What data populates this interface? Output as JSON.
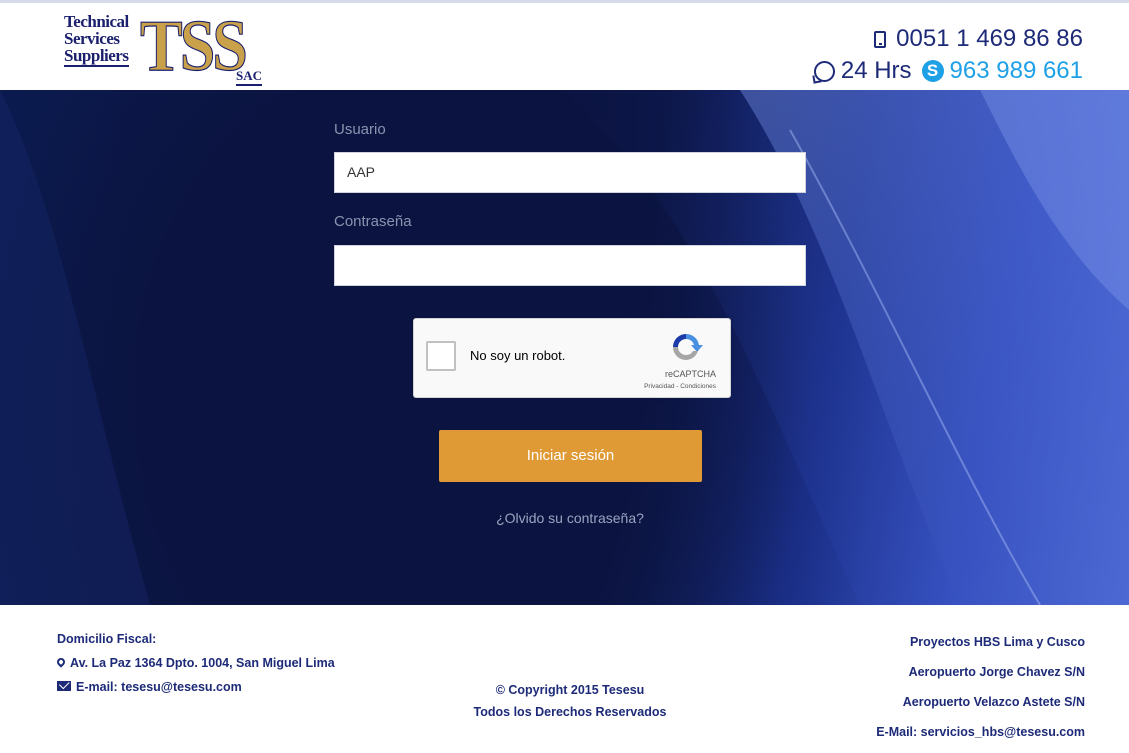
{
  "header": {
    "logo": {
      "line1": "Technical",
      "line2": "Services",
      "line3": "Suppliers",
      "letters": "TSS",
      "suffix": "SAC"
    },
    "phone": "0051 1 469 86 86",
    "hours": "24 Hrs",
    "skype_number": "963 989 661"
  },
  "login": {
    "username_label": "Usuario",
    "username_value": "AAP",
    "password_label": "Contraseña",
    "password_value": "",
    "captcha": {
      "checkbox_label": "No soy un robot.",
      "brand": "reCAPTCHA",
      "links": "Privacidad - Condiciones"
    },
    "submit_label": "Iniciar sesión",
    "forgot_label": "¿Olvido su contraseña?"
  },
  "footer": {
    "left": {
      "title": "Domicilio Fiscal:",
      "address": "Av. La Paz 1364 Dpto. 1004, San Miguel Lima",
      "email_label": "E-mail:",
      "email": "tesesu@tesesu.com"
    },
    "center": {
      "copyright": "© Copyright 2015 Tesesu",
      "rights": "Todos los Derechos Reservados"
    },
    "right": {
      "line1": "Proyectos HBS Lima y Cusco",
      "line2": "Aeropuerto Jorge Chavez S/N",
      "line3": "Aeropuerto Velazco Astete S/N",
      "line4": "E-Mail: servicios_hbs@tesesu.com"
    }
  },
  "colors": {
    "brand_navy": "#1d2a78",
    "accent_orange": "#df9935",
    "skype_blue": "#1ea0e6",
    "hero_dark": "#0b1440"
  }
}
